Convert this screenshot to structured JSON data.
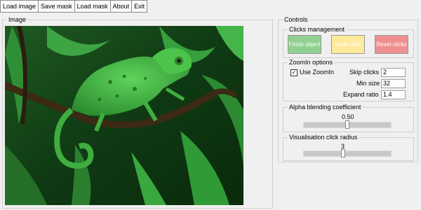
{
  "menu": {
    "load_image": "Load image",
    "save_mask": "Save mask",
    "load_mask": "Load mask",
    "about": "About",
    "exit": "Exit"
  },
  "image_panel": {
    "title": "Image"
  },
  "controls": {
    "title": "Controls",
    "clicks": {
      "title": "Clicks management",
      "finish": "Finish object",
      "undo": "Undo click",
      "reset": "Reset clicks",
      "finish_color": "#90d090",
      "undo_color": "#ffe99a",
      "reset_color": "#ef8f8f"
    },
    "zoomin": {
      "title": "ZoomIn options",
      "use_label": "Use ZoomIn",
      "use_checked": "✓",
      "skip_label": "Skip clicks",
      "skip_value": "2",
      "min_label": "Min size",
      "min_value": "32",
      "ratio_label": "Expand ratio",
      "ratio_value": "1.4"
    },
    "alpha": {
      "title": "Alpha blending coefficient",
      "value": "0.50",
      "level": 0.5
    },
    "radius": {
      "title": "Visualisation click radius",
      "value": "3",
      "level": 0.45
    }
  }
}
